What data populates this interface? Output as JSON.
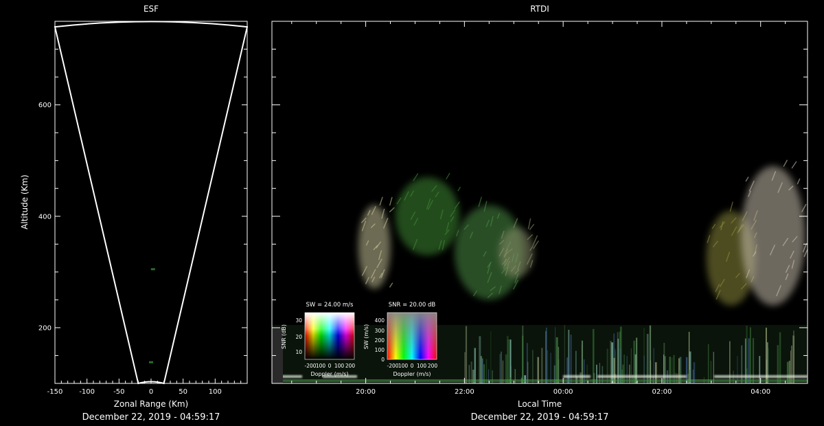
{
  "chart_data": [
    {
      "type": "scatter",
      "panel": "esf",
      "title": "ESF",
      "xlabel": "Zonal Range (Km)",
      "ylabel": "Altitude (Km)",
      "footer": "December 22, 2019 - 04:59:17",
      "xlim": [
        -150,
        150
      ],
      "ylim": [
        100,
        750
      ],
      "xticks": [
        -150,
        -100,
        -50,
        0,
        50,
        100
      ],
      "yticks": [
        200,
        400,
        600
      ],
      "beam_outline": {
        "bottom_altitude": 100,
        "top_altitude": 740,
        "bottom_range": [
          -20,
          20
        ],
        "top_range": [
          -150,
          150
        ]
      },
      "echoes": [
        {
          "x": 3,
          "y": 305
        },
        {
          "x": 0,
          "y": 138
        }
      ]
    },
    {
      "type": "heatmap",
      "panel": "rtdi",
      "title": "RTDI",
      "xlabel": "Local Time",
      "footer": "December 22, 2019 - 04:59:17",
      "xticks": [
        "20:00",
        "22:00",
        "00:00",
        "02:00",
        "04:00"
      ],
      "xtick_hours": [
        20,
        22,
        24,
        26,
        28
      ],
      "xlim_hours": [
        18.1,
        28.95
      ],
      "ylim": [
        100,
        750
      ],
      "grid": false,
      "plumes": [
        {
          "t_start": 19.85,
          "t_end": 20.5,
          "alt_bottom": 270,
          "alt_top": 420,
          "color": "#c8c49a"
        },
        {
          "t_start": 20.6,
          "t_end": 21.9,
          "alt_bottom": 330,
          "alt_top": 470,
          "color": "#3f8a36"
        },
        {
          "t_start": 21.8,
          "t_end": 23.2,
          "alt_bottom": 250,
          "alt_top": 420,
          "color": "#4c8e45"
        },
        {
          "t_start": 22.7,
          "t_end": 23.4,
          "alt_bottom": 290,
          "alt_top": 380,
          "color": "#8a8f6a"
        },
        {
          "t_start": 26.9,
          "t_end": 27.9,
          "alt_bottom": 240,
          "alt_top": 410,
          "color": "#8c8a3c"
        },
        {
          "t_start": 27.6,
          "t_end": 28.9,
          "alt_bottom": 240,
          "alt_top": 490,
          "color": "#c8bfae"
        }
      ],
      "bottom_layer": {
        "alt_bottom": 100,
        "alt_top": 205,
        "color": "#3a5a3a"
      },
      "legends": [
        {
          "title": "SW = 24.00 m/s",
          "ylabel": "SNR (dB)",
          "xlabel": "Doppler (m/s)",
          "yticks": [
            "30",
            "20",
            "10"
          ],
          "xticks": [
            "-200",
            "100",
            "0",
            "100",
            "200"
          ]
        },
        {
          "title": "SNR = 20.00 dB",
          "ylabel": "SW (m/s)",
          "xlabel": "Doppler (m/s)",
          "yticks": [
            "400",
            "300",
            "200",
            "100",
            "0"
          ],
          "xticks": [
            "-200",
            "100",
            "0",
            "100",
            "200"
          ]
        }
      ]
    }
  ]
}
